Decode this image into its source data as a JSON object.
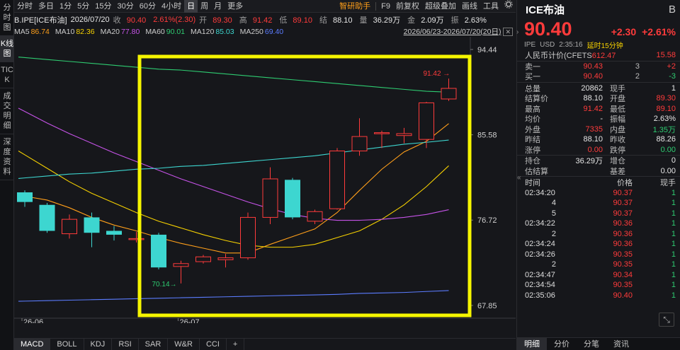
{
  "left_tabs": [
    {
      "label": "分时图",
      "active": false
    },
    {
      "label": "K线图",
      "active": true
    },
    {
      "label": "TICK",
      "active": false
    },
    {
      "label": "成交明细",
      "active": false
    },
    {
      "label": "深度资料",
      "active": false
    }
  ],
  "toolbar": {
    "periods": [
      "分时",
      "多日",
      "1分",
      "5分",
      "15分",
      "30分",
      "60分",
      "4小时",
      "日",
      "周",
      "月",
      "更多"
    ],
    "active_period": "日",
    "tools": [
      "智研助手",
      "F9",
      "前复权",
      "超级叠加",
      "画线",
      "工具"
    ],
    "settings_icon": "gear-icon"
  },
  "info": {
    "symbol": "B.IPE[ICE布油]",
    "date": "2026/07/20",
    "close_label": "收",
    "close": "90.40",
    "change": "2.61%(2.30)",
    "open_label": "开",
    "open": "89.30",
    "high_label": "高",
    "high": "91.42",
    "low_label": "低",
    "low": "89.10",
    "settle_label": "结",
    "settle": "88.10",
    "vol_label": "量",
    "vol": "36.29万",
    "amount_label": "金",
    "amount": "2.09万",
    "amp_label": "振",
    "amp": "2.63%"
  },
  "ma": {
    "items": [
      {
        "name": "MA5",
        "value": "86.74",
        "color": "#ff9f1a"
      },
      {
        "name": "MA10",
        "value": "82.36",
        "color": "#f5d000"
      },
      {
        "name": "MA20",
        "value": "77.80",
        "color": "#c653e8"
      },
      {
        "name": "MA60",
        "value": "90.01",
        "color": "#2ecc71"
      },
      {
        "name": "MA120",
        "value": "85.03",
        "color": "#3dd6d0"
      },
      {
        "name": "MA250",
        "value": "69.40",
        "color": "#5b7cff"
      }
    ],
    "range": "2026/06/23-2026/07/20(20日)"
  },
  "chart_data": {
    "type": "candlestick",
    "y_ticks": [
      "94.44",
      "85.58",
      "76.72",
      "67.85"
    ],
    "ylim": [
      67.85,
      94.44
    ],
    "x_ticks": [
      "26-06",
      "26-07"
    ],
    "annotations": [
      {
        "label": "91.42",
        "type": "high_marker"
      },
      {
        "label": "70.14",
        "type": "low_marker"
      }
    ],
    "candles": [
      {
        "o": 79.6,
        "c": 78.6,
        "h": 79.8,
        "l": 78.1
      },
      {
        "o": 78.3,
        "c": 75.6,
        "h": 78.5,
        "l": 75.4
      },
      {
        "o": 75.3,
        "c": 76.8,
        "h": 77.3,
        "l": 74.8
      },
      {
        "o": 77.0,
        "c": 75.4,
        "h": 77.5,
        "l": 73.9
      },
      {
        "o": 75.6,
        "c": 75.2,
        "h": 76.1,
        "l": 74.6
      },
      {
        "o": 74.8,
        "c": 74.8,
        "h": 75.5,
        "l": 74.4
      },
      {
        "o": 75.2,
        "c": 71.8,
        "h": 75.4,
        "l": 71.6
      },
      {
        "o": 71.9,
        "c": 72.2,
        "h": 72.5,
        "l": 70.14
      },
      {
        "o": 72.4,
        "c": 72.9,
        "h": 73.1,
        "l": 72.2
      },
      {
        "o": 72.6,
        "c": 72.8,
        "h": 73.2,
        "l": 71.8
      },
      {
        "o": 72.8,
        "c": 77.0,
        "h": 77.5,
        "l": 72.6
      },
      {
        "o": 77.0,
        "c": 81.0,
        "h": 82.2,
        "l": 76.3
      },
      {
        "o": 80.9,
        "c": 77.0,
        "h": 81.1,
        "l": 76.8
      },
      {
        "o": 76.6,
        "c": 77.6,
        "h": 77.8,
        "l": 76.3
      },
      {
        "o": 77.9,
        "c": 83.9,
        "h": 84.2,
        "l": 77.8
      },
      {
        "o": 83.9,
        "c": 85.4,
        "h": 87.3,
        "l": 83.4
      },
      {
        "o": 85.8,
        "c": 85.8,
        "h": 86.0,
        "l": 84.2
      },
      {
        "o": 85.5,
        "c": 85.7,
        "h": 86.3,
        "l": 84.7
      },
      {
        "o": 85.1,
        "c": 88.9,
        "h": 89.0,
        "l": 84.2
      },
      {
        "o": 89.3,
        "c": 90.4,
        "h": 91.42,
        "l": 89.1
      }
    ],
    "ma_series": [
      {
        "name": "MA5",
        "color": "#ff9f1a",
        "values": [
          79.2,
          78.8,
          78.0,
          77.0,
          76.2,
          75.6,
          74.9,
          74.3,
          73.8,
          73.3,
          73.3,
          74.2,
          75.0,
          75.8,
          77.5,
          79.8,
          82.0,
          83.8,
          84.9,
          86.74
        ]
      },
      {
        "name": "MA10",
        "color": "#f5d000",
        "values": [
          83.5,
          82.1,
          80.7,
          79.5,
          78.5,
          77.5,
          76.6,
          75.9,
          75.2,
          74.6,
          74.1,
          73.9,
          73.9,
          74.2,
          74.9,
          75.6,
          76.8,
          78.3,
          80.2,
          82.36
        ]
      },
      {
        "name": "MA20",
        "color": "#c653e8",
        "values": [
          88.0,
          86.8,
          85.7,
          84.7,
          83.7,
          82.8,
          81.9,
          81.0,
          80.2,
          79.4,
          78.6,
          77.9,
          77.3,
          76.9,
          76.7,
          76.7,
          76.8,
          77.0,
          77.3,
          77.8
        ]
      },
      {
        "name": "MA60",
        "color": "#2ecc71",
        "values": [
          93.6,
          93.4,
          93.2,
          93.0,
          92.8,
          92.6,
          92.4,
          92.3,
          92.1,
          91.9,
          91.7,
          91.5,
          91.3,
          91.1,
          90.9,
          90.7,
          90.5,
          90.3,
          90.1,
          90.01
        ]
      },
      {
        "name": "MA120",
        "color": "#3dd6d0",
        "values": [
          81.1,
          81.3,
          81.5,
          81.6,
          81.8,
          82.0,
          82.1,
          82.3,
          82.4,
          82.6,
          82.8,
          83.0,
          83.2,
          83.4,
          83.7,
          84.0,
          84.3,
          84.6,
          84.8,
          85.03
        ]
      },
      {
        "name": "MA250",
        "color": "#5b7cff",
        "values": [
          68.3,
          68.35,
          68.4,
          68.45,
          68.5,
          68.55,
          68.6,
          68.65,
          68.7,
          68.75,
          68.8,
          68.85,
          68.9,
          68.95,
          69.0,
          69.1,
          69.15,
          69.2,
          69.3,
          69.4
        ]
      }
    ]
  },
  "indicator_tabs": [
    "MACD",
    "BOLL",
    "KDJ",
    "RSI",
    "SAR",
    "W&R",
    "CCI",
    "+"
  ],
  "quote": {
    "name": "ICE布油",
    "badge": "B",
    "price": "90.40",
    "change": "+2.30",
    "change_pct": "+2.61%",
    "exchange": "IPE",
    "currency": "USD",
    "time": "2:35:16",
    "delay": "延时15分钟",
    "rmb_label": "人民币计价(CFETS",
    "rmb_price": "612.47",
    "rmb_change": "15.58",
    "sell1": {
      "label": "卖一",
      "price": "90.43",
      "vol": "3",
      "chg": "+2"
    },
    "buy1": {
      "label": "买一",
      "price": "90.40",
      "vol": "2",
      "chg": "-3"
    },
    "stats": [
      {
        "l1": "总量",
        "v1": "20862",
        "c1": "white",
        "l2": "现手",
        "v2": "1",
        "c2": "white"
      },
      {
        "l1": "结算价",
        "v1": "88.10",
        "c1": "white",
        "l2": "开盘",
        "v2": "89.30",
        "c2": "red"
      },
      {
        "l1": "最高",
        "v1": "91.42",
        "c1": "red",
        "l2": "最低",
        "v2": "89.10",
        "c2": "red"
      },
      {
        "l1": "均价",
        "v1": "-",
        "c1": "white",
        "l2": "振幅",
        "v2": "2.63%",
        "c2": "white"
      },
      {
        "l1": "外盘",
        "v1": "7335",
        "c1": "red",
        "l2": "内盘",
        "v2": "1.35万",
        "c2": "green"
      },
      {
        "l1": "昨结",
        "v1": "88.10",
        "c1": "white",
        "l2": "昨收",
        "v2": "88.26",
        "c2": "white"
      },
      {
        "l1": "涨停",
        "v1": "0.00",
        "c1": "red",
        "l2": "跌停",
        "v2": "0.00",
        "c2": "green"
      }
    ],
    "stats2": [
      {
        "l1": "持仓",
        "v1": "36.29万",
        "c1": "white",
        "l2": "增仓",
        "v2": "0",
        "c2": "white"
      },
      {
        "l1": "估结算",
        "v1": "",
        "c1": "white",
        "l2": "基差",
        "v2": "0.00",
        "c2": "white"
      }
    ]
  },
  "ticks": {
    "headers": [
      "时间",
      "价格",
      "现手"
    ],
    "rows": [
      {
        "time": "02:34:20",
        "price": "90.37",
        "vol": "1",
        "short": false
      },
      {
        "time": "4",
        "price": "90.37",
        "vol": "1",
        "short": true
      },
      {
        "time": "5",
        "price": "90.37",
        "vol": "1",
        "short": true
      },
      {
        "time": "02:34:22",
        "price": "90.36",
        "vol": "1",
        "short": false
      },
      {
        "time": "2",
        "price": "90.36",
        "vol": "1",
        "short": true
      },
      {
        "time": "02:34:24",
        "price": "90.36",
        "vol": "1",
        "short": false
      },
      {
        "time": "02:34:26",
        "price": "90.35",
        "vol": "1",
        "short": false
      },
      {
        "time": "2",
        "price": "90.35",
        "vol": "1",
        "short": true
      },
      {
        "time": "02:34:47",
        "price": "90.34",
        "vol": "1",
        "short": false
      },
      {
        "time": "02:34:54",
        "price": "90.35",
        "vol": "1",
        "short": false
      },
      {
        "time": "02:35:06",
        "price": "90.40",
        "vol": "1",
        "short": false
      }
    ]
  },
  "right_tabs": [
    "明细",
    "分价",
    "分笔",
    "资讯"
  ]
}
